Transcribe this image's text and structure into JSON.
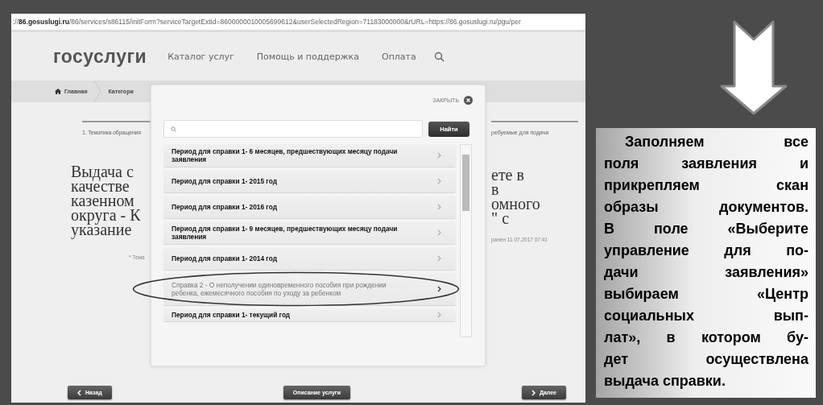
{
  "screenshot": {
    "url": "://**86.gosuslugi.ru**/86/services/s86115/initForm?serviceTargetExtId=8600000010005699612&userSelectedRegion=71183000000&rURL=https://86.gosuslugi.ru/pgu/per",
    "header": {
      "logo": "госуслуги",
      "nav": [
        "Каталог услуг",
        "Помощь и поддержка",
        "Оплата"
      ]
    },
    "breadcrumbs": [
      "Главная",
      "Категори"
    ],
    "step_left": "1. Тематика обращения",
    "step_right": "ребуемые для подачи",
    "title_left": [
      "Выдача с",
      "качестве",
      "казенном",
      "округа - К",
      "указание"
    ],
    "title_right": [
      "ете в",
      "в",
      "омного",
      "\" с"
    ],
    "note_left": "* Тема",
    "note_right": "ранен 11.07.2017 07:41",
    "modal": {
      "close_label": "ЗАКРЫТЬ",
      "search_button": "Найти",
      "items": [
        {
          "text": "Период для справки 1- 6 месяцев, предшествующих месяцу подачи заявления",
          "kind": "period",
          "circled": false
        },
        {
          "text": "Период для справки 1- 2015 год",
          "kind": "period",
          "circled": false
        },
        {
          "text": "Период для справки 1- 2016 год",
          "kind": "period",
          "circled": false
        },
        {
          "text": "Период для справки 1- 9 месяцев, предшествующих месяцу подачи заявления",
          "kind": "period",
          "circled": false
        },
        {
          "text": "Период для справки 1- 2014 год",
          "kind": "period",
          "circled": false
        },
        {
          "text": "Справка 2 - О неполучении единовременного пособия при рождении ребенка, ежемесячного пособия по уходу за ребенком",
          "kind": "certificate",
          "circled": true
        },
        {
          "text": "Период для справки 1- текущий год",
          "kind": "period",
          "circled": false
        }
      ]
    },
    "buttons": [
      {
        "label": "Назад",
        "kind": "back"
      },
      {
        "label": "Описание услуги",
        "kind": "plain"
      },
      {
        "label": "Далее",
        "kind": "next"
      }
    ]
  },
  "callout": {
    "lines": [
      "Заполняем все",
      "поля заявления и",
      "прикрепляем скан",
      "образы документов.",
      "В поле «Выберите",
      "управление для по-",
      "дачи заявления»",
      "выбираем «Центр",
      "социальных вып-",
      "лат», в котором бу-",
      "дет осуществлена",
      "выдача справки."
    ]
  }
}
